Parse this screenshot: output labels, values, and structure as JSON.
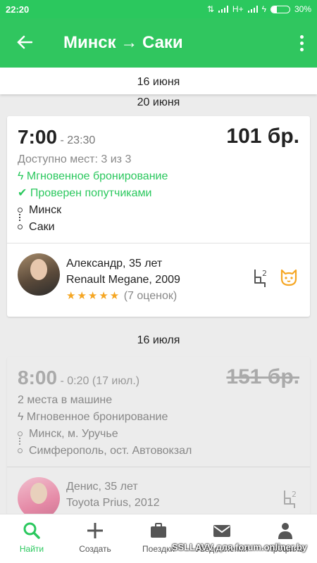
{
  "status_bar": {
    "time": "22:20",
    "network": "H+",
    "battery": "30%",
    "battery_level": 0.3
  },
  "app_bar": {
    "title": "Минск → Саки"
  },
  "sticky_date": "16 июня",
  "sections": [
    {
      "date": "20 июня",
      "trip": {
        "departure": "7:00",
        "arrival": "- 23:30",
        "price": "101 бр.",
        "seats": "Доступно мест: 3 из 3",
        "feature1": "Мгновенное бронирование",
        "feature2": "Проверен попутчиками",
        "from": "Минск",
        "to": "Саки",
        "driver": {
          "name": "Александр, 35 лет",
          "car": "Renault Megane, 2009",
          "stars": "★★★★★",
          "rating_count": "(7 оценок)"
        }
      }
    },
    {
      "date": "16 июля",
      "trip": {
        "departure": "8:00",
        "arrival": "- 0:20 (17 июл.)",
        "price": "151 бр.",
        "seats": "2 места в машине",
        "feature1": "Мгновенное бронирование",
        "from": "Минск, м. Уручье",
        "to": "Симферополь, ост. Автовокзал",
        "driver": {
          "name": "Денис, 35 лет",
          "car": "Toyota Prius, 2012"
        }
      }
    }
  ],
  "bottom_nav": [
    {
      "label": "Найти",
      "icon": "search-icon",
      "active": true
    },
    {
      "label": "Создать",
      "icon": "plus-icon",
      "active": false
    },
    {
      "label": "Поездки",
      "icon": "briefcase-icon",
      "active": false
    },
    {
      "label": "Уведомления",
      "icon": "mail-icon",
      "active": false
    },
    {
      "label": "Профиль",
      "icon": "person-icon",
      "active": false
    }
  ],
  "watermark": "SSLLAVV для forum.onliner.by",
  "colors": {
    "brand": "#30c65f",
    "star": "#f5a623",
    "pet": "#f5a623"
  }
}
